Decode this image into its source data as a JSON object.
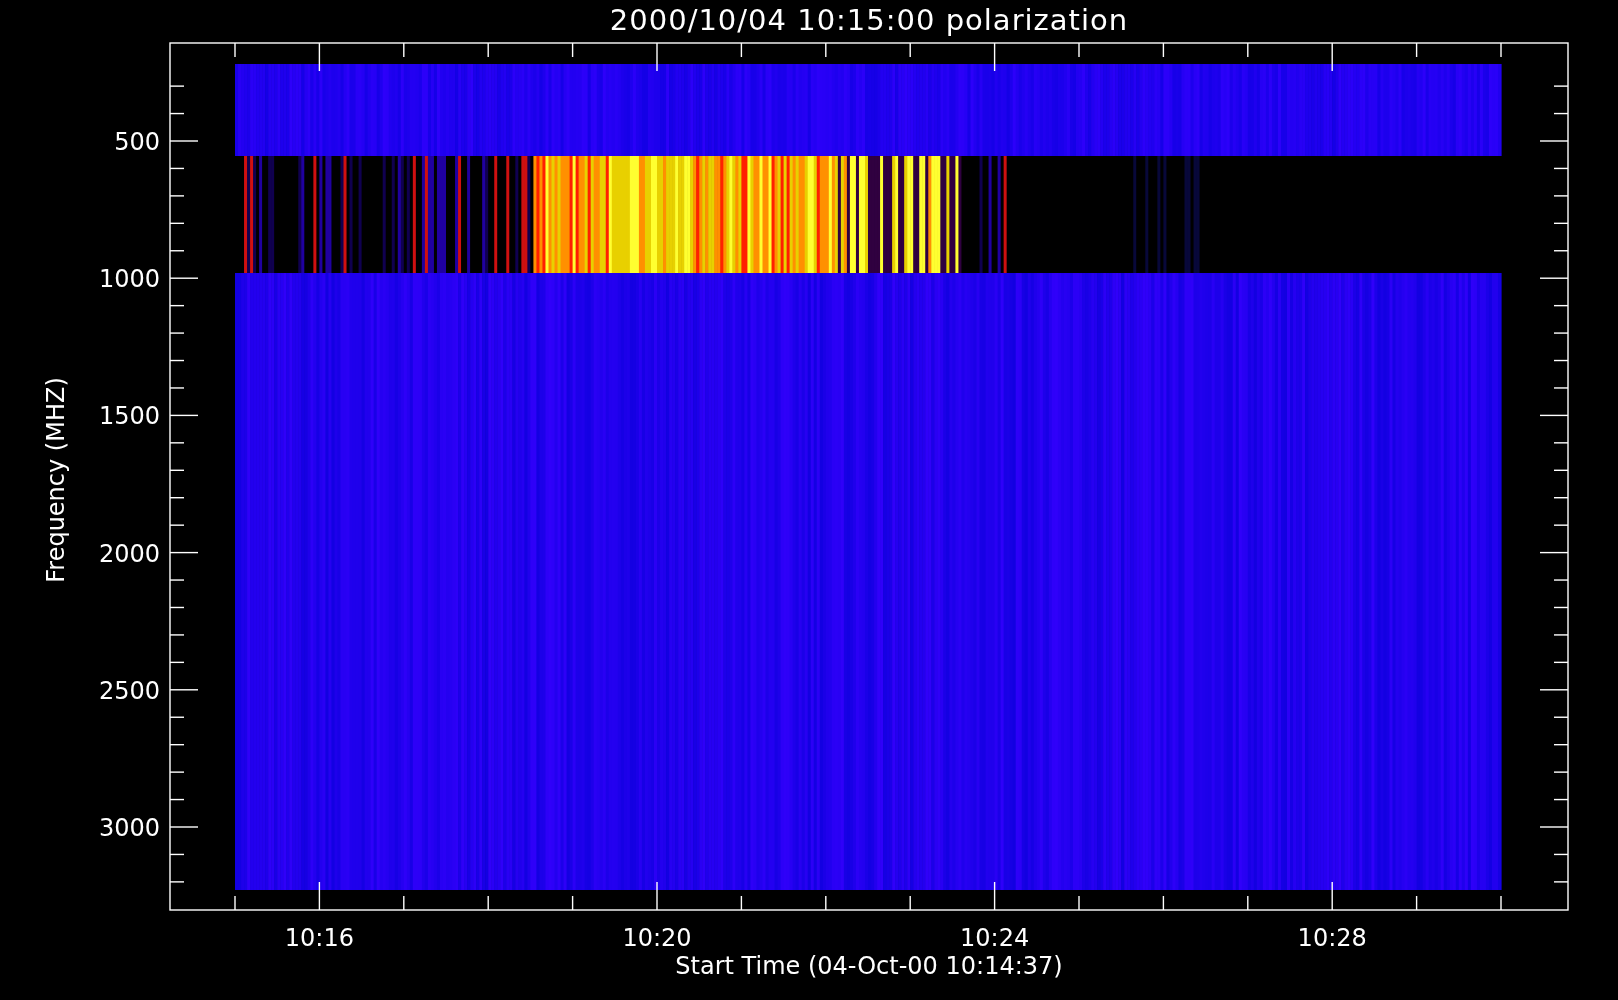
{
  "chart": {
    "title": "2000/10/04 10:15:00 polarization",
    "xlabel": "Start Time (04-Oct-00 10:14:37)",
    "ylabel": "Frequency (MHZ)",
    "xtick_labels": [
      "10:16",
      "10:20",
      "10:24",
      "10:28"
    ],
    "ytick_labels": [
      "500",
      "1000",
      "1500",
      "2000",
      "2500",
      "3000"
    ]
  }
}
